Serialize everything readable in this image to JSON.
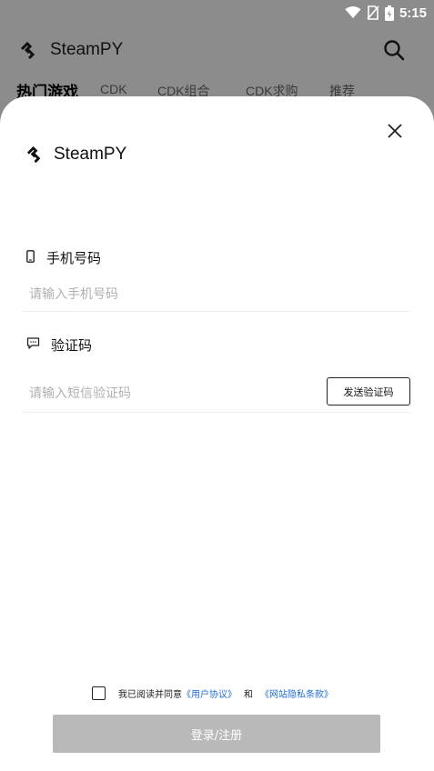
{
  "status_bar": {
    "time": "5:15",
    "icons": [
      "wifi-icon",
      "no-sim-icon",
      "battery-icon"
    ]
  },
  "app": {
    "brand": "SteamPY",
    "tabs": [
      {
        "label": "热门游戏",
        "active": true
      },
      {
        "label": "CDK",
        "active": false
      },
      {
        "label": "CDK组合",
        "active": false
      },
      {
        "label": "CDK求购",
        "active": false
      },
      {
        "label": "推荐",
        "active": false
      }
    ]
  },
  "login_sheet": {
    "brand": "SteamPY",
    "phone": {
      "label": "手机号码",
      "value": "",
      "placeholder": "请输入手机号码",
      "icon": "phone-icon"
    },
    "code": {
      "label": "验证码",
      "value": "",
      "placeholder": "请输入短信验证码",
      "icon": "message-icon",
      "send_button": "发送验证码"
    },
    "agreement": {
      "checked": false,
      "prefix": "我已阅读并同意",
      "user_agreement": "《用户协议》",
      "and": "和",
      "privacy": "《网站隐私条款》"
    },
    "submit_label": "登录/注册"
  },
  "colors": {
    "overlay_background": "#8c8c8c",
    "link": "#1f6fd1",
    "submit_disabled": "#b9b9b9"
  }
}
